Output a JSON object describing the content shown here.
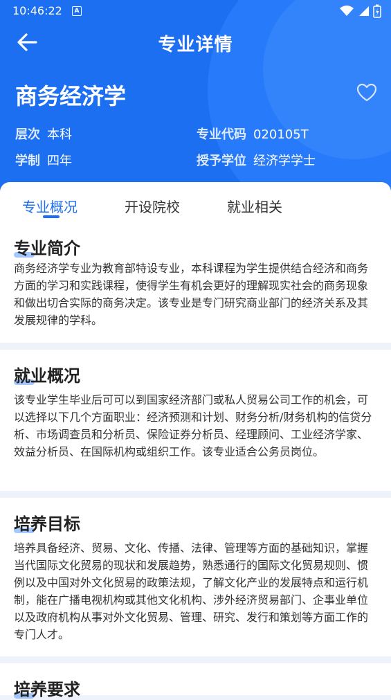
{
  "status": {
    "time": "10:46:22",
    "a_icon": "A"
  },
  "topbar": {
    "title": "专业详情",
    "back_icon": "arrow-left-icon",
    "favorite_icon": "heart-outline-icon"
  },
  "major": {
    "name": "商务经济学",
    "level_label": "层次",
    "level_value": "本科",
    "code_label": "专业代码",
    "code_value": "020105T",
    "duration_label": "学制",
    "duration_value": "四年",
    "degree_label": "授予学位",
    "degree_value": "经济学学士"
  },
  "tabs": [
    {
      "label": "专业概况",
      "active": true
    },
    {
      "label": "开设院校",
      "active": false
    },
    {
      "label": "就业相关",
      "active": false
    }
  ],
  "sections": [
    {
      "title": "专业简介",
      "body": "商务经济学专业为教育部特设专业，本科课程为学生提供结合经济和商务方面的学习和实践课程，使得学生有机会更好的理解现实社会的商务现象和做出切合实际的商务决定。该专业是专门研究商业部门的经济关系及其发展规律的学科。"
    },
    {
      "title": "就业概况",
      "body": "该专业学生毕业后可可以到国家经济部门或私人贸易公司工作的机会，可以选择以下几个方面职业：经济预测和计划、财务分析/财务机构的信贷分析、市场调查员和分析员、保险证券分析员、经理顾问、工业经济学家、效益分析员、在国际机构或组织工作。该专业适合公务员岗位。"
    },
    {
      "title": "培养目标",
      "body": "培养具备经济、贸易、文化、传播、法律、管理等方面的基础知识，掌握当代国际文化贸易的现状和发展趋势，熟悉通行的国际文化贸易规则、惯例以及中国对外文化贸易的政策法规，了解文化产业的发展特点和运行机制，能在广播电视机构或其他文化机构、涉外经济贸易部门、企事业单位以及政府机构从事对外文化贸易、管理、研究、发行和策划等方面工作的专门人才。"
    },
    {
      "title": "培养要求",
      "body": ""
    }
  ],
  "colors": {
    "primary": "#1d6ff2",
    "background": "#eef3fb"
  }
}
